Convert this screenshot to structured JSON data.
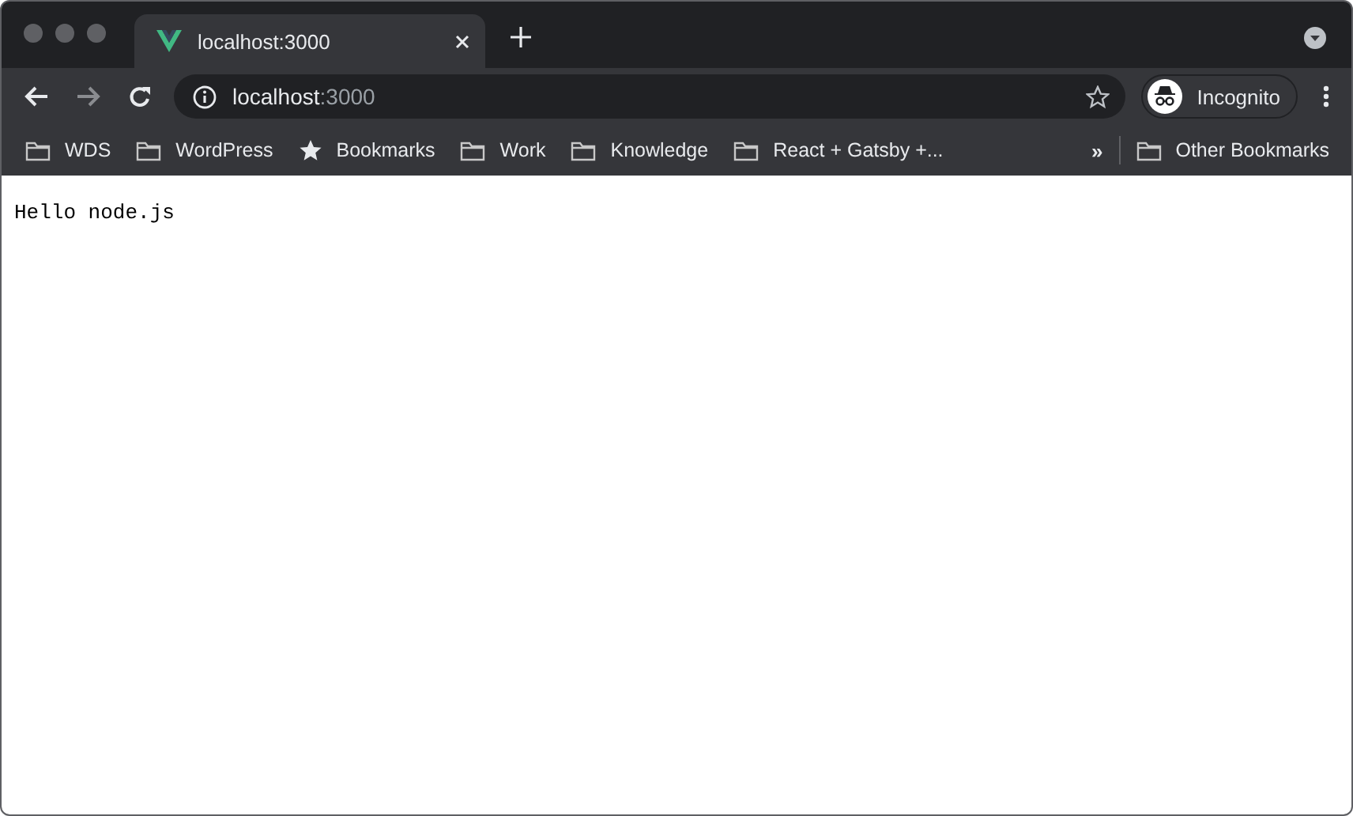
{
  "tabs": [
    {
      "title": "localhost:3000",
      "selected": true
    }
  ],
  "address": {
    "host": "localhost",
    "port": ":3000"
  },
  "profile": {
    "label": "Incognito"
  },
  "bookmarks": [
    {
      "kind": "folder",
      "label": "WDS"
    },
    {
      "kind": "folder",
      "label": "WordPress"
    },
    {
      "kind": "star",
      "label": "Bookmarks"
    },
    {
      "kind": "folder",
      "label": "Work"
    },
    {
      "kind": "folder",
      "label": "Knowledge"
    },
    {
      "kind": "folder",
      "label": "React + Gatsby +..."
    }
  ],
  "overflow": "»",
  "other_bookmarks": {
    "kind": "folder",
    "label": "Other Bookmarks"
  },
  "page": {
    "text": "Hello node.js"
  }
}
